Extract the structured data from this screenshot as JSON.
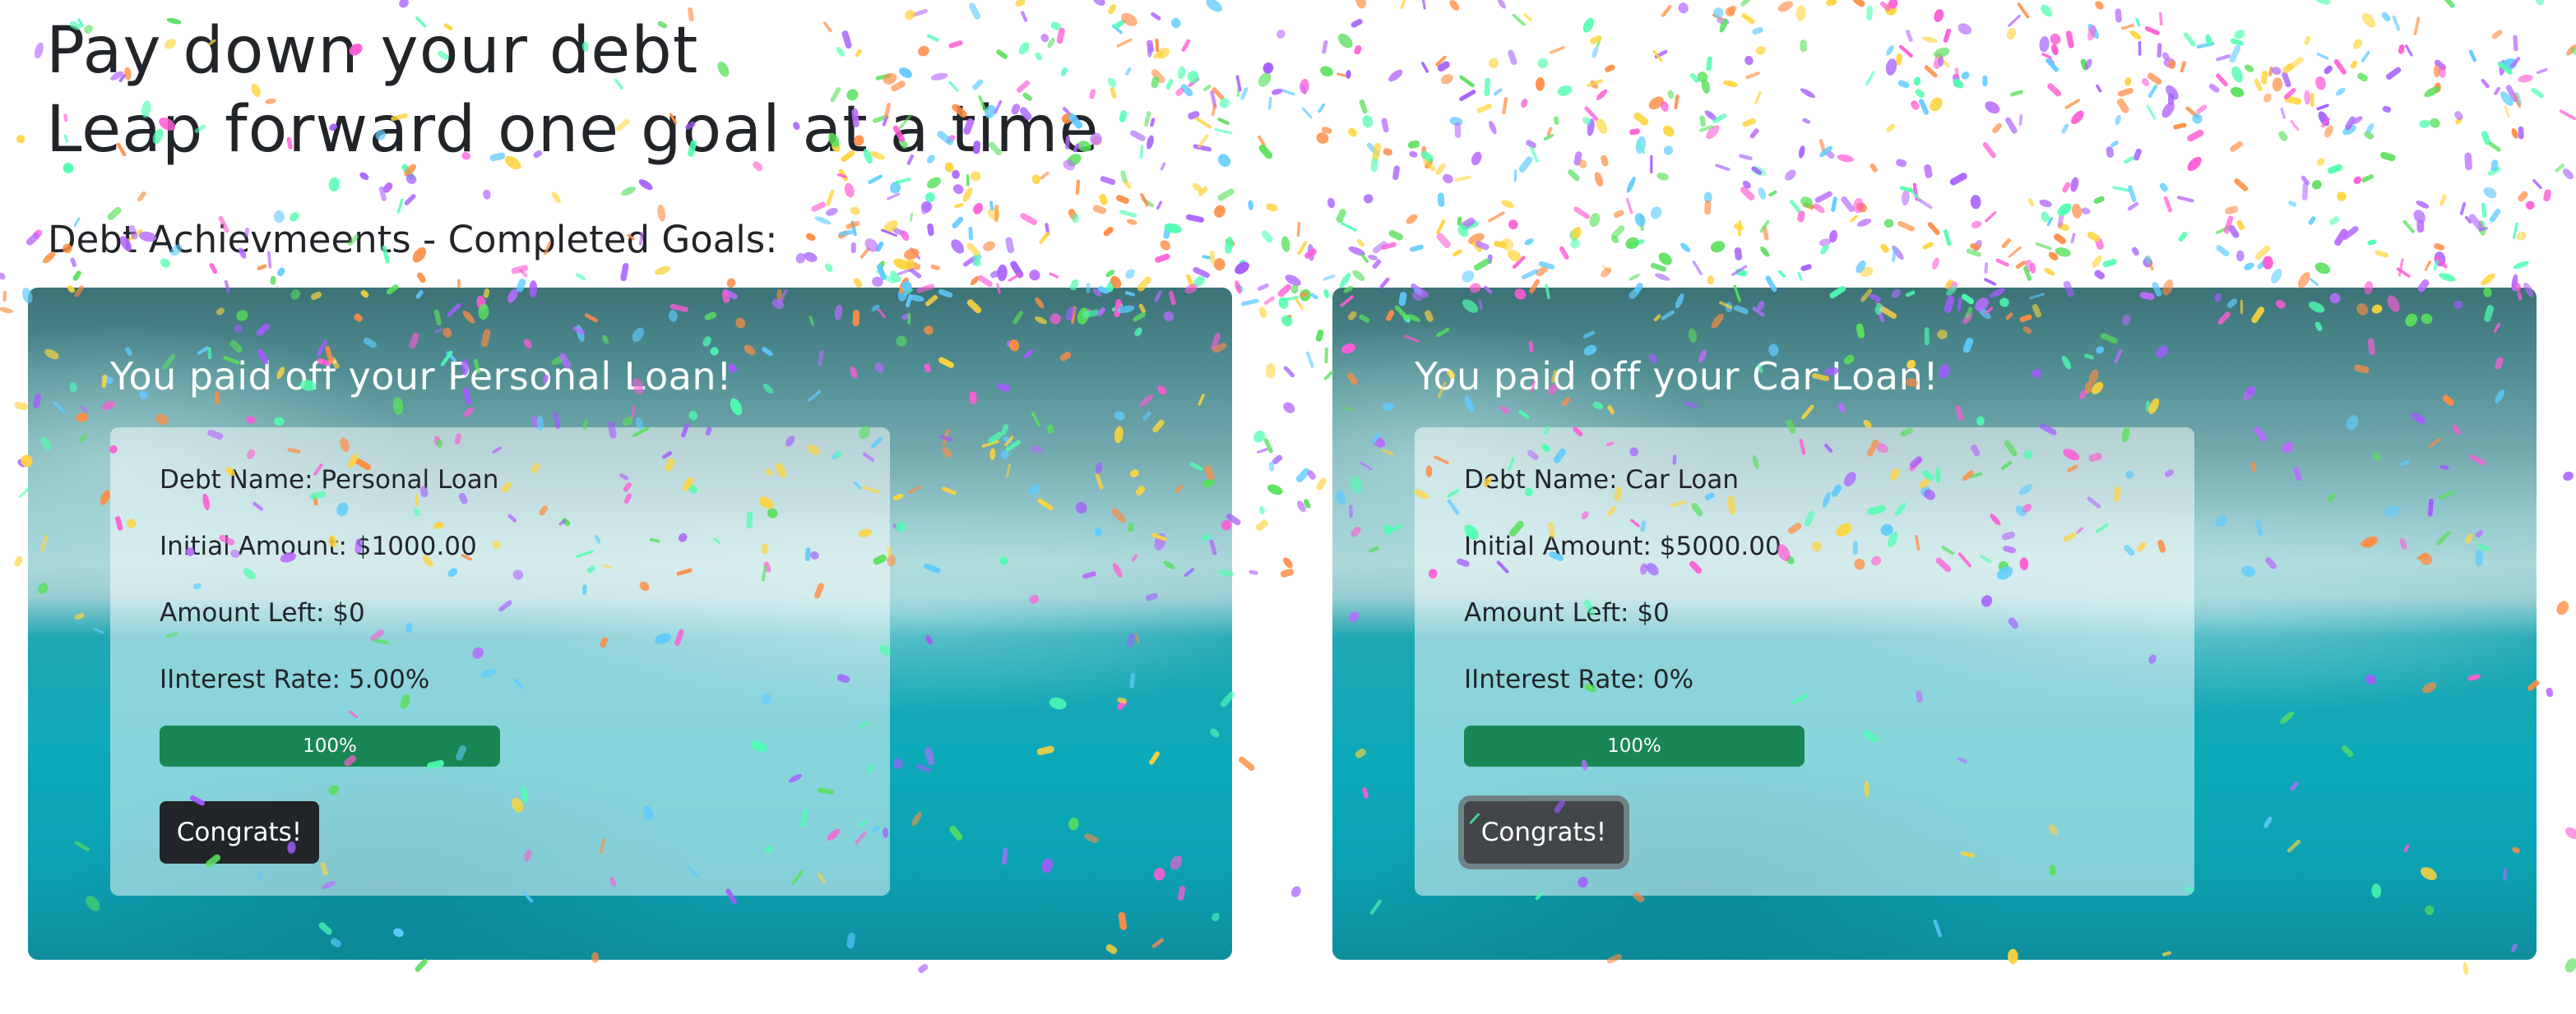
{
  "header": {
    "title_line_1": "Pay down your debt",
    "title_line_2": "Leap forward one goal at a time"
  },
  "section": {
    "heading": "Debt Achievmeents - Completed Goals:"
  },
  "cards": [
    {
      "title": "You paid off your Personal Loan!",
      "debt_name_label": "Debt Name:",
      "debt_name_value": "Personal Loan",
      "initial_amount_label": "Initial Amount:",
      "initial_amount_value": "$1000.00",
      "amount_left_label": "Amount Left:",
      "amount_left_value": "$0",
      "interest_rate_label": "IInterest Rate:",
      "interest_rate_value": "5.00%",
      "progress_value": 1,
      "progress_label": "100%",
      "button_label": "Congrats!"
    },
    {
      "title": "You paid off your Car Loan!",
      "debt_name_label": "Debt Name:",
      "debt_name_value": "Car Loan",
      "initial_amount_label": "Initial Amount:",
      "initial_amount_value": "$5000.00",
      "amount_left_label": "Amount Left:",
      "amount_left_value": "$0",
      "interest_rate_label": "IInterest Rate:",
      "interest_rate_value": "0%",
      "progress_value": 1,
      "progress_label": "100%",
      "button_label": "Congrats!",
      "button_focused": true
    }
  ],
  "colors": {
    "text_dark": "#212529",
    "progress_green": "#198754",
    "button_dark": "#212529",
    "confetti": [
      "#ff5bd6",
      "#a45bff",
      "#5ecbff",
      "#58e05b",
      "#ffd43b",
      "#ff8c42",
      "#4dffb2",
      "#b86bff"
    ]
  }
}
